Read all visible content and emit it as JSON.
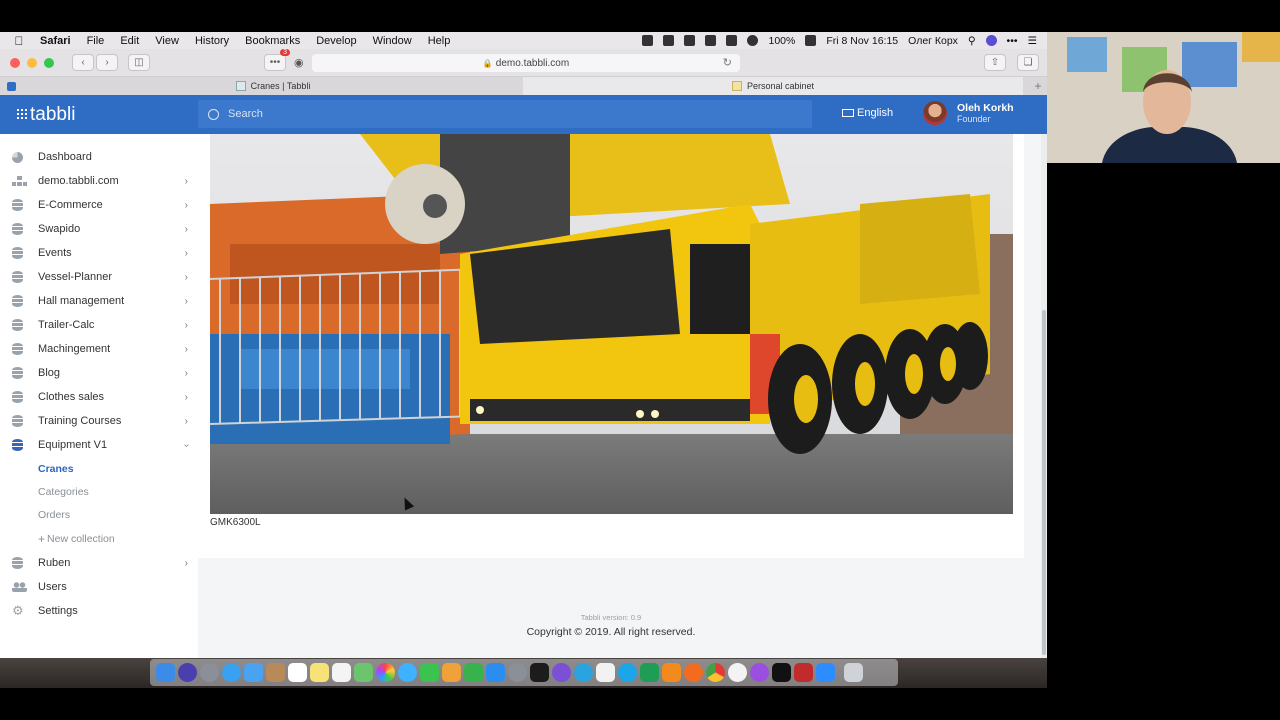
{
  "menubar": {
    "app": "Safari",
    "menus": [
      "File",
      "Edit",
      "View",
      "History",
      "Bookmarks",
      "Develop",
      "Window",
      "Help"
    ],
    "battery": "100%",
    "datetime": "Fri 8 Nov 16:15",
    "user": "Олег Корх"
  },
  "browser": {
    "url": "demo.tabbli.com",
    "tabs": [
      "Cranes | Tabbli",
      "Personal cabinet"
    ],
    "notification_badge": "3"
  },
  "header": {
    "logo": "tabbli",
    "search_placeholder": "Search",
    "language": "English",
    "user_name": "Oleh Korkh",
    "user_role": "Founder"
  },
  "sidebar": {
    "items": [
      {
        "label": "Dashboard"
      },
      {
        "label": "demo.tabbli.com"
      },
      {
        "label": "E-Commerce"
      },
      {
        "label": "Swapido"
      },
      {
        "label": "Events"
      },
      {
        "label": "Vessel-Planner"
      },
      {
        "label": "Hall management"
      },
      {
        "label": "Trailer-Calc"
      },
      {
        "label": "Machingement"
      },
      {
        "label": "Blog"
      },
      {
        "label": "Clothes sales"
      },
      {
        "label": "Training Courses"
      },
      {
        "label": "Equipment V1"
      },
      {
        "label": "Ruben"
      },
      {
        "label": "Users"
      },
      {
        "label": "Settings"
      }
    ],
    "subitems": [
      "Cranes",
      "Categories",
      "Orders",
      "New collection"
    ]
  },
  "content": {
    "caption": "GMK6300L",
    "version": "Tabbli version: 0.9",
    "copyright": "Copyright © 2019. All right reserved."
  },
  "colors": {
    "brand_blue": "#2f6dc4",
    "active_link": "#2d66bf",
    "crane_yellow": "#f2c50f"
  }
}
